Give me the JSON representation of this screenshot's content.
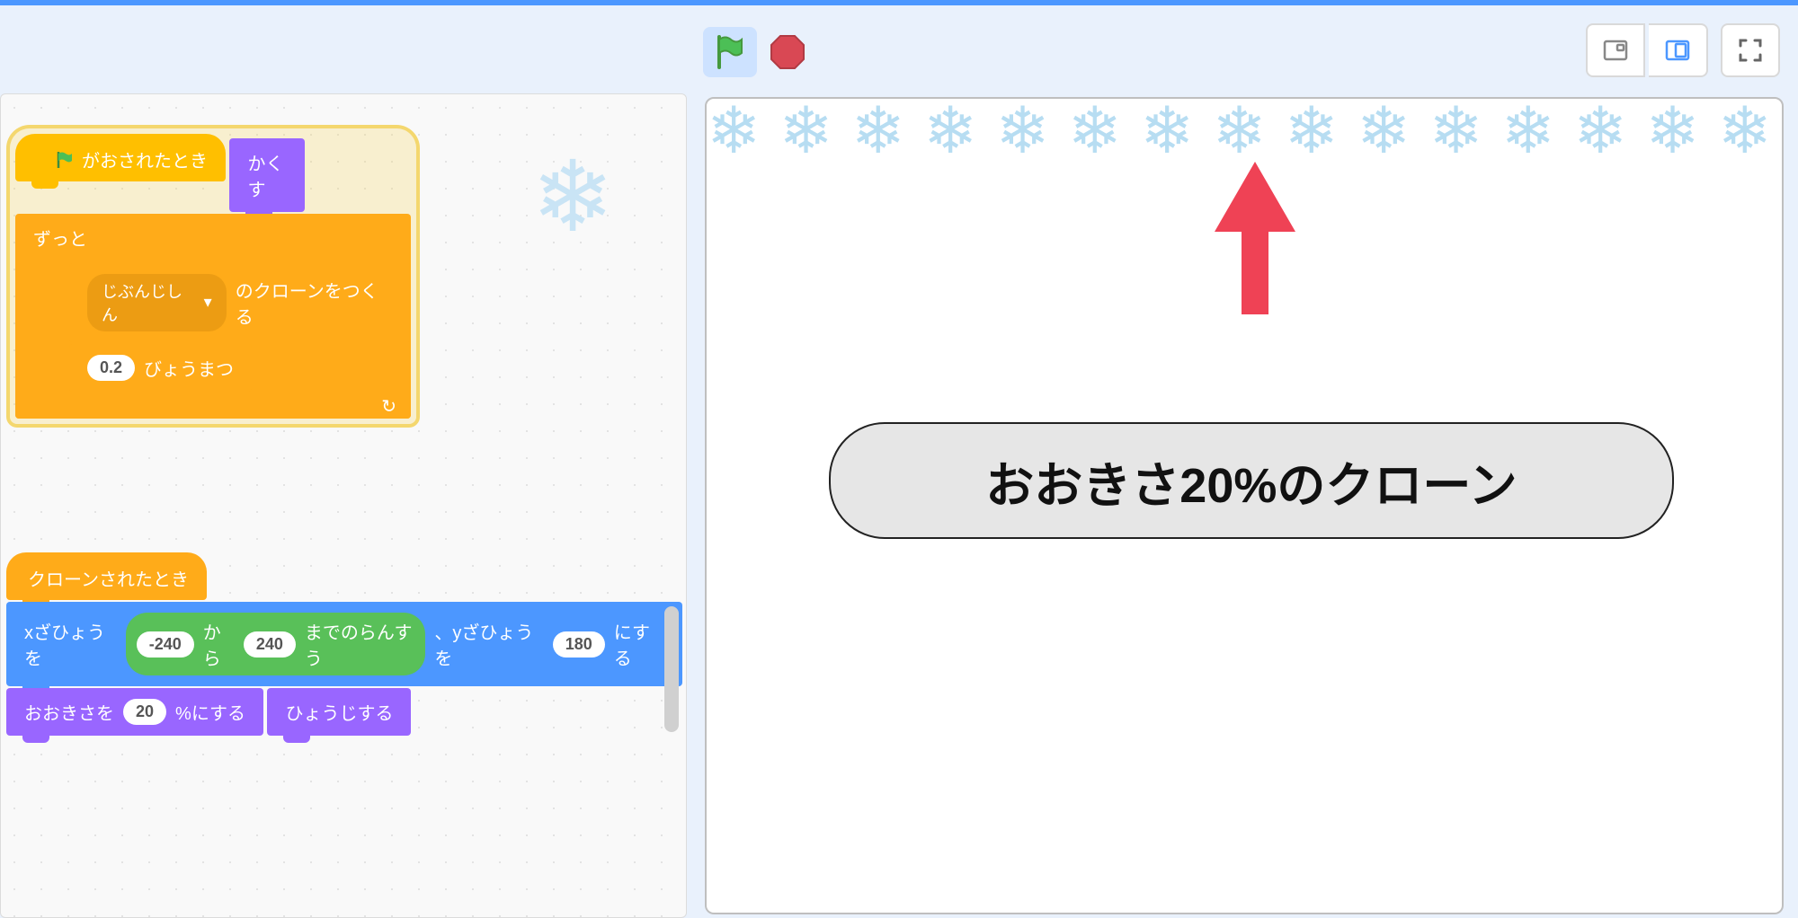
{
  "controls": {
    "green_flag": "green-flag",
    "stop": "stop"
  },
  "view": {
    "small": "small-stage",
    "large": "large-stage",
    "fullscreen": "fullscreen"
  },
  "scripts": {
    "stack1": {
      "hat": "がおされたとき",
      "hide": "かくす",
      "forever": "ずっと",
      "clone_prefix": "",
      "clone_target": "じぶんじしん",
      "clone_suffix": "のクローンをつくる",
      "wait_value": "0.2",
      "wait_suffix": "びょうまつ"
    },
    "stack2": {
      "hat": "クローンされたとき",
      "goto_x_label": "xざひょうを",
      "rand_from": "-240",
      "rand_mid": "から",
      "rand_to": "240",
      "rand_suffix": "までのらんすう",
      "goto_y_label": "、yざひょうを",
      "goto_y_val": "180",
      "goto_suffix": "にする",
      "size_label": "おおきさを",
      "size_val": "20",
      "size_suffix": "%にする",
      "show": "ひょうじする"
    }
  },
  "stage": {
    "callout": "おおきさ20%のクローン"
  }
}
